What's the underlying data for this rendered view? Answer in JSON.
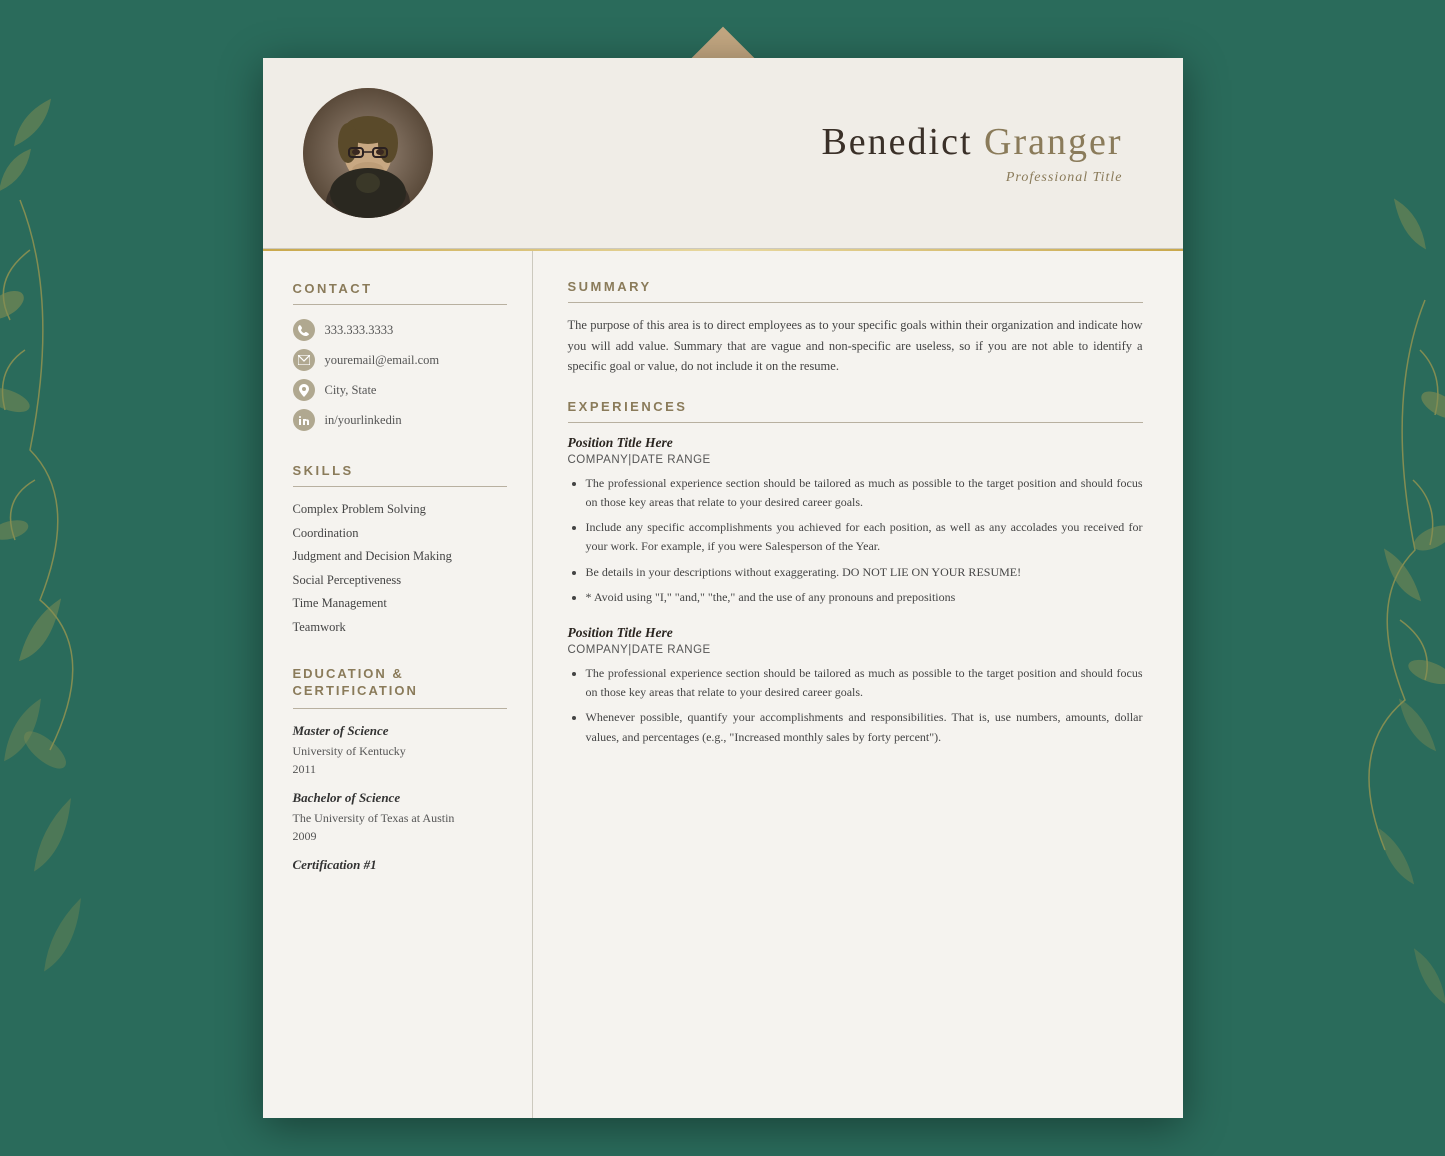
{
  "background": {
    "color": "#2a6b5b"
  },
  "header": {
    "name_first": "Benedict",
    "name_last": "Granger",
    "title": "Professional Title"
  },
  "contact": {
    "section_label": "CONTACT",
    "phone": "333.333.3333",
    "email": "youremail@email.com",
    "location": "City, State",
    "linkedin": "in/yourlinkedin"
  },
  "skills": {
    "section_label": "SKILLS",
    "items": [
      "Complex Problem Solving",
      "Coordination",
      "Judgment and Decision Making",
      "Social Perceptiveness",
      "Time Management",
      "Teamwork"
    ]
  },
  "education": {
    "section_label": "EDUCATION &",
    "section_label2": "CERTIFICATION",
    "degrees": [
      {
        "degree": "Master of Science",
        "school": "University of Kentucky",
        "year": "2011"
      },
      {
        "degree": "Bachelor of Science",
        "school": "The University of Texas at Austin",
        "year": "2009"
      }
    ],
    "cert_label": "Certification #1"
  },
  "summary": {
    "section_label": "SUMMARY",
    "text": "The purpose of this area is to direct employees as to your specific goals within their organization and indicate how you will add value. Summary that are vague and non-specific are useless, so if you are not able to identify a specific goal or value, do not include it on the resume."
  },
  "experiences": {
    "section_label": "EXPERIENCES",
    "items": [
      {
        "position": "Position Title Here",
        "company": "COMPANY|DATE RANGE",
        "bullets": [
          "The professional experience section should be tailored as much as possible to the target position and should focus on those key areas that relate to your desired career goals.",
          "Include any specific accomplishments you achieved for each position, as well as any accolades you received for your work.  For example, if you were Salesperson of the Year.",
          "Be details in your descriptions without exaggerating.  DO NOT LIE ON YOUR RESUME!",
          "* Avoid using \"I,\" \"and,\" \"the,\" and the use of any pronouns and prepositions"
        ]
      },
      {
        "position": "Position Title Here",
        "company": "COMPANY|DATE RANGE",
        "bullets": [
          "The professional experience section should be tailored as much as possible to the target position and should focus on those key areas that relate to your desired career goals.",
          "Whenever possible, quantify your accomplishments and responsibilities. That is, use numbers, amounts, dollar values, and percentages (e.g., \"Increased monthly sales by forty percent\")."
        ]
      }
    ]
  }
}
